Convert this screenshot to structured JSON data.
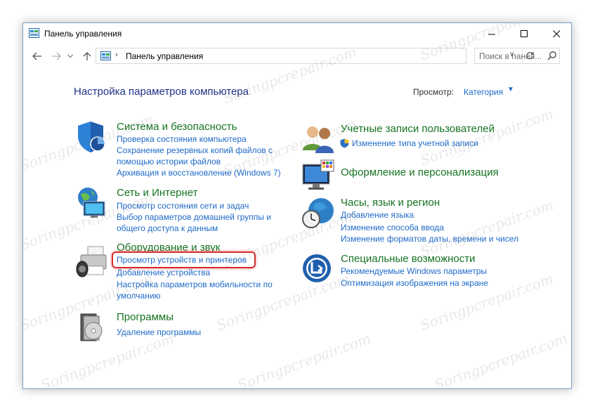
{
  "window": {
    "title": "Панель управления"
  },
  "address": {
    "path": "Панель управления",
    "search_placeholder": "Поиск в панел..."
  },
  "header": {
    "title": "Настройка параметров компьютера",
    "view_label": "Просмотр:",
    "view_value": "Категория"
  },
  "categories": {
    "system": {
      "title": "Система и безопасность",
      "links": [
        "Проверка состояния компьютера",
        "Сохранение резервных копий файлов с",
        "помощью истории файлов",
        "Архивация и восстановление (Windows 7)"
      ]
    },
    "network": {
      "title": "Сеть и Интернет",
      "links": [
        "Просмотр состояния сети и задач",
        "Выбор параметров домашней группы и",
        "общего доступа к данным"
      ]
    },
    "hardware": {
      "title": "Оборудование и звук",
      "links": [
        "Просмотр устройств и принтеров",
        "Добавление устройства",
        "Настройка параметров мобильности по",
        "умолчанию"
      ]
    },
    "programs": {
      "title": "Программы",
      "links": [
        "Удаление программы"
      ]
    },
    "users": {
      "title": "Учетные записи пользователей",
      "links": [
        "Изменение типа учетной записи"
      ]
    },
    "appearance": {
      "title": "Оформление и персонализация",
      "links": []
    },
    "clock": {
      "title": "Часы, язык и регион",
      "links": [
        "Добавление языка",
        "Изменение способа ввода",
        "Изменение форматов даты, времени и чисел"
      ]
    },
    "access": {
      "title": "Специальные возможности",
      "links": [
        "Рекомендуемые Windows параметры",
        "Оптимизация изображения на экране"
      ]
    }
  },
  "watermark": "Soringpcrepair.com"
}
